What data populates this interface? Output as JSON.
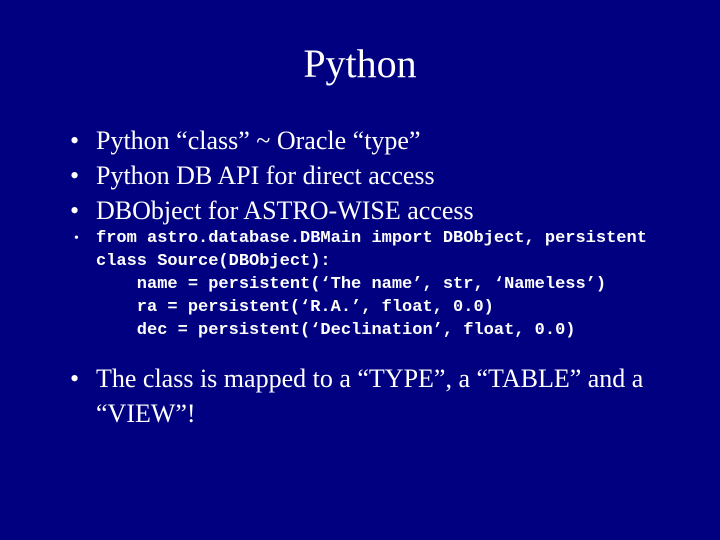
{
  "slide": {
    "title": "Python",
    "bullets": {
      "b1": "Python “class” ~ Oracle “type”",
      "b2": "Python DB API for direct access",
      "b3": "DBObject for ASTRO-WISE access",
      "b4_code_line1": "from astro.database.DBMain import DBObject, persistent",
      "b4_code_block": "class Source(DBObject):\n    name = persistent(‘The name’, str, ‘Nameless’)\n    ra = persistent(‘R.A.’, float, 0.0)\n    dec = persistent(‘Declination’, float, 0.0)",
      "b5": "The class is mapped to a “TYPE”, a “TABLE” and a “VIEW”!"
    }
  }
}
